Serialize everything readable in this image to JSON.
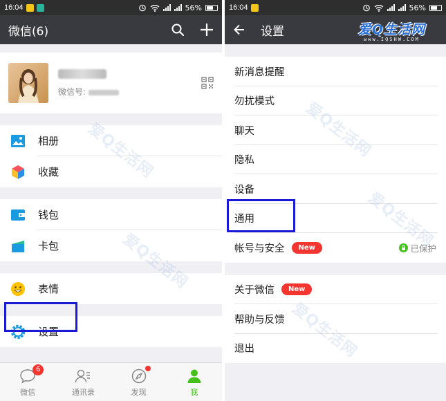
{
  "status_left": {
    "time": "16:04",
    "battery": "56%"
  },
  "status_right": {
    "time": "16:04",
    "battery": "56%"
  },
  "left": {
    "title": "微信(6)",
    "profile": {
      "wechat_id_label": "微信号:"
    },
    "menu": [
      {
        "label": "相册",
        "icon": "photo-album-icon"
      },
      {
        "label": "收藏",
        "icon": "favorites-cube-icon"
      },
      {
        "label": "钱包",
        "icon": "wallet-icon"
      },
      {
        "label": "卡包",
        "icon": "card-package-icon"
      },
      {
        "label": "表情",
        "icon": "sticker-smiley-icon"
      },
      {
        "label": "设置",
        "icon": "gear-icon"
      }
    ],
    "tabs": [
      {
        "label": "微信",
        "badge": "6"
      },
      {
        "label": "通讯录"
      },
      {
        "label": "发现"
      },
      {
        "label": "我"
      }
    ]
  },
  "right": {
    "title": "设置",
    "brand": {
      "logo": "爱Q生活网",
      "url": "www.IQSHW.COM"
    },
    "items": [
      {
        "label": "新消息提醒"
      },
      {
        "label": "勿扰模式"
      },
      {
        "label": "聊天"
      },
      {
        "label": "隐私"
      },
      {
        "label": "设备"
      },
      {
        "label": "通用"
      },
      {
        "label": "帐号与安全",
        "badge": "New",
        "status": "已保护"
      },
      {
        "label": "关于微信",
        "badge": "New"
      },
      {
        "label": "帮助与反馈"
      },
      {
        "label": "退出"
      }
    ]
  },
  "colors": {
    "titlebar": "#393a3f",
    "statusbar": "#2e2e2e",
    "background": "#efeff4",
    "active_green": "#45c01a",
    "badge_red": "#f43530",
    "highlight_blue": "#1a1ad6"
  }
}
